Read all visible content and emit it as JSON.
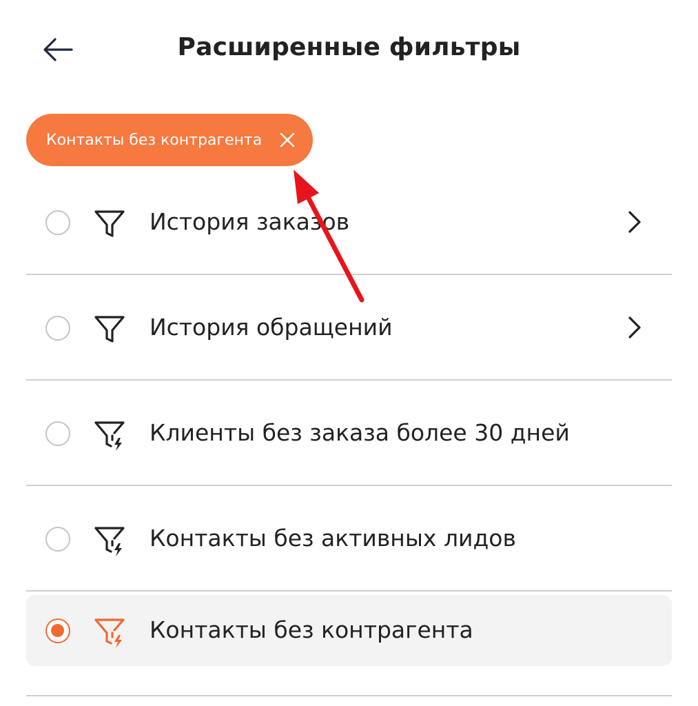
{
  "header": {
    "title": "Расширенные фильтры",
    "back_icon": "arrow-left-icon"
  },
  "active_chip": {
    "label": "Контакты без контрагента",
    "close_icon": "close-icon",
    "color": "#f6793f"
  },
  "filters": [
    {
      "label": "История заказов",
      "icon": "filter-icon",
      "selected": false,
      "has_chevron": true
    },
    {
      "label": "История обращений",
      "icon": "filter-icon",
      "selected": false,
      "has_chevron": true
    },
    {
      "label": "Клиенты без заказа более 30 дней",
      "icon": "filter-lightning-icon",
      "selected": false,
      "has_chevron": false
    },
    {
      "label": "Контакты без активных лидов",
      "icon": "filter-lightning-icon",
      "selected": false,
      "has_chevron": false
    },
    {
      "label": "Контакты без контрагента",
      "icon": "filter-lightning-icon",
      "selected": true,
      "has_chevron": false
    }
  ],
  "colors": {
    "accent": "#f06a30",
    "annotation_arrow": "#e8141b"
  }
}
